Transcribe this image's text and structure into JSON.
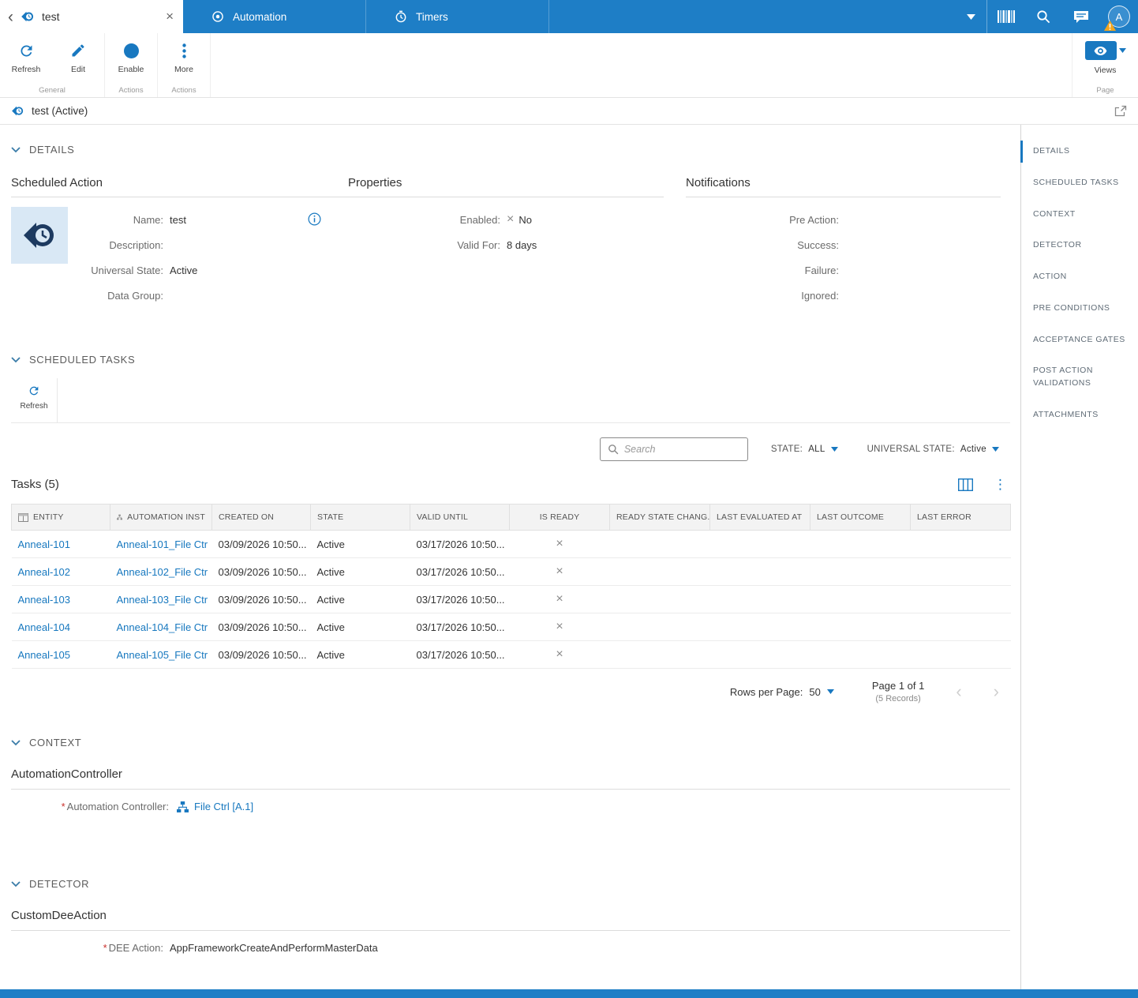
{
  "colors": {
    "topbar_blue": "#1e7ec6",
    "link_blue": "#1778bf",
    "accent_blue": "#1878c0",
    "warning_yellow": "#f2a51e",
    "thumb_navy": "#1d3a60",
    "thumb_bg": "#d9e8f5"
  },
  "icons": {
    "cross": "×",
    "back_chevron": "‹",
    "prev_chevron": "‹",
    "next_chevron": "›",
    "kebab": "⋮"
  },
  "topbar": {
    "page_tab_title": "test",
    "tabs": [
      {
        "label": "Automation"
      },
      {
        "label": "Timers"
      }
    ],
    "avatar_initial": "A"
  },
  "toolbar": {
    "buttons": [
      {
        "label": "Refresh"
      },
      {
        "label": "Edit"
      },
      {
        "label": "Enable"
      },
      {
        "label": "More"
      }
    ],
    "views_label": "Views",
    "group_labels": {
      "general": "General",
      "actions_enable": "Actions",
      "actions_more": "Actions",
      "page": "Page"
    }
  },
  "breadcrumb": {
    "title": "test (Active)"
  },
  "details": {
    "title": "DETAILS",
    "scheduled_action": {
      "title": "Scheduled Action",
      "fields": [
        {
          "label": "Name:",
          "value": "test"
        },
        {
          "label": "Description:",
          "value": ""
        },
        {
          "label": "Universal State:",
          "value": "Active"
        },
        {
          "label": "Data Group:",
          "value": ""
        }
      ]
    },
    "properties": {
      "title": "Properties",
      "enabled_label": "Enabled:",
      "enabled_value": "No",
      "valid_for_label": "Valid For:",
      "valid_for_value": "8 days"
    },
    "notifications": {
      "title": "Notifications",
      "fields": [
        {
          "label": "Pre Action:"
        },
        {
          "label": "Success:"
        },
        {
          "label": "Failure:"
        },
        {
          "label": "Ignored:"
        }
      ]
    }
  },
  "scheduled_tasks": {
    "title": "SCHEDULED TASKS",
    "refresh_label": "Refresh",
    "search_placeholder": "Search",
    "state_filter_label": "STATE:",
    "state_filter_value": "ALL",
    "universal_filter_label": "UNIVERSAL STATE:",
    "universal_filter_value": "Active"
  },
  "tasks": {
    "title": "Tasks (5)",
    "columns": [
      "ENTITY",
      "AUTOMATION INST",
      "CREATED ON",
      "STATE",
      "VALID UNTIL",
      "IS READY",
      "READY STATE CHANG...",
      "LAST EVALUATED AT",
      "LAST OUTCOME",
      "LAST ERROR"
    ],
    "rows": [
      {
        "entity": "Anneal-101",
        "automation_instance": "Anneal-101_File Ctr",
        "created_on": "03/09/2026 10:50...",
        "state": "Active",
        "valid_until": "03/17/2026 10:50..."
      },
      {
        "entity": "Anneal-102",
        "automation_instance": "Anneal-102_File Ctr",
        "created_on": "03/09/2026 10:50...",
        "state": "Active",
        "valid_until": "03/17/2026 10:50..."
      },
      {
        "entity": "Anneal-103",
        "automation_instance": "Anneal-103_File Ctr",
        "created_on": "03/09/2026 10:50...",
        "state": "Active",
        "valid_until": "03/17/2026 10:50..."
      },
      {
        "entity": "Anneal-104",
        "automation_instance": "Anneal-104_File Ctr",
        "created_on": "03/09/2026 10:50...",
        "state": "Active",
        "valid_until": "03/17/2026 10:50..."
      },
      {
        "entity": "Anneal-105",
        "automation_instance": "Anneal-105_File Ctr",
        "created_on": "03/09/2026 10:50...",
        "state": "Active",
        "valid_until": "03/17/2026 10:50..."
      }
    ],
    "pagination": {
      "rows_per_page_label": "Rows per Page:",
      "rows_per_page_value": "50",
      "page_text": "Page 1 of 1",
      "records_text": "(5 Records)"
    }
  },
  "context": {
    "title": "CONTEXT",
    "subtitle": "AutomationController",
    "required_marker": "*",
    "field_label": "Automation Controller:",
    "field_value": "File Ctrl [A.1]"
  },
  "detector": {
    "title": "DETECTOR",
    "subtitle": "CustomDeeAction",
    "required_marker": "*",
    "field_label": "DEE Action:",
    "field_value": "AppFrameworkCreateAndPerformMasterData"
  },
  "sidebar": {
    "items": [
      {
        "label": "DETAILS",
        "active": true
      },
      {
        "label": "SCHEDULED TASKS",
        "active": false
      },
      {
        "label": "CONTEXT",
        "active": false
      },
      {
        "label": "DETECTOR",
        "active": false
      },
      {
        "label": "ACTION",
        "active": false
      },
      {
        "label": "PRE CONDITIONS",
        "active": false
      },
      {
        "label": "ACCEPTANCE GATES",
        "active": false
      },
      {
        "label": "POST ACTION VALIDATIONS",
        "active": false
      },
      {
        "label": "ATTACHMENTS",
        "active": false
      }
    ]
  }
}
